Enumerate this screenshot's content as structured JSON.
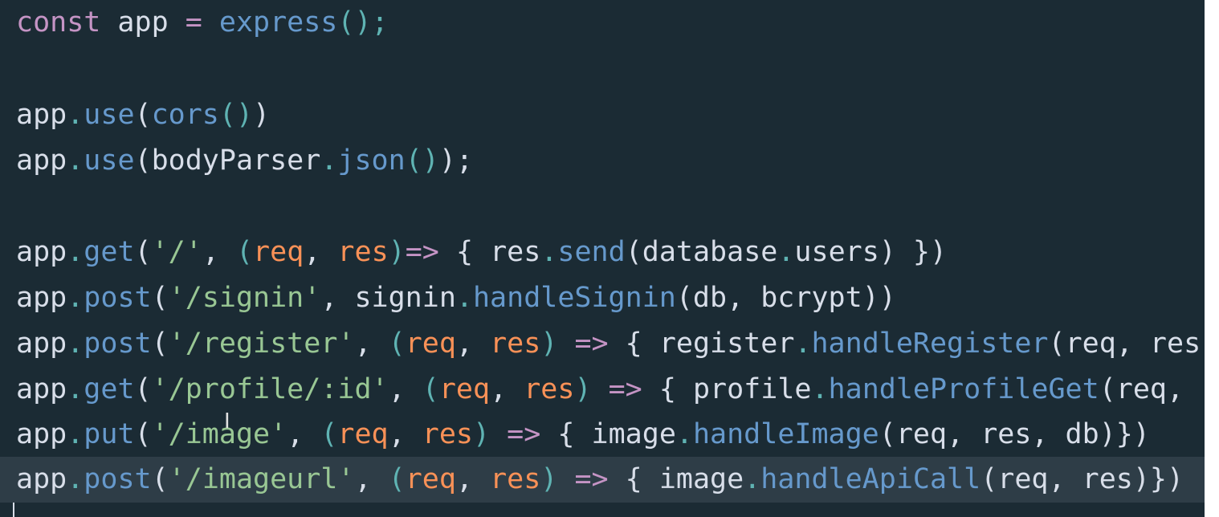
{
  "editor": {
    "lines": [
      {
        "tokens": [
          {
            "t": "const",
            "c": "kw"
          },
          {
            "t": " app ",
            "c": "id"
          },
          {
            "t": "=",
            "c": "op"
          },
          {
            "t": " ",
            "c": "id"
          },
          {
            "t": "express",
            "c": "fn"
          },
          {
            "t": "();",
            "c": "punc"
          }
        ]
      },
      {
        "tokens": []
      },
      {
        "tokens": [
          {
            "t": "app",
            "c": "id"
          },
          {
            "t": ".",
            "c": "punc"
          },
          {
            "t": "use",
            "c": "fn"
          },
          {
            "t": "(",
            "c": "id"
          },
          {
            "t": "cors",
            "c": "fn"
          },
          {
            "t": "()",
            "c": "punc"
          },
          {
            "t": ")",
            "c": "id"
          }
        ]
      },
      {
        "tokens": [
          {
            "t": "app",
            "c": "id"
          },
          {
            "t": ".",
            "c": "punc"
          },
          {
            "t": "use",
            "c": "fn"
          },
          {
            "t": "(bodyParser",
            "c": "id"
          },
          {
            "t": ".",
            "c": "punc"
          },
          {
            "t": "json",
            "c": "fn"
          },
          {
            "t": "()",
            "c": "punc"
          },
          {
            "t": ");",
            "c": "id"
          }
        ]
      },
      {
        "tokens": []
      },
      {
        "tokens": [
          {
            "t": "app",
            "c": "id"
          },
          {
            "t": ".",
            "c": "punc"
          },
          {
            "t": "get",
            "c": "fn"
          },
          {
            "t": "(",
            "c": "id"
          },
          {
            "t": "'/'",
            "c": "str"
          },
          {
            "t": ", ",
            "c": "id"
          },
          {
            "t": "(",
            "c": "punc"
          },
          {
            "t": "req",
            "c": "param"
          },
          {
            "t": ", ",
            "c": "id"
          },
          {
            "t": "res",
            "c": "param"
          },
          {
            "t": ")",
            "c": "punc"
          },
          {
            "t": "=>",
            "c": "op"
          },
          {
            "t": " { res",
            "c": "id"
          },
          {
            "t": ".",
            "c": "punc"
          },
          {
            "t": "send",
            "c": "fn"
          },
          {
            "t": "(database",
            "c": "id"
          },
          {
            "t": ".",
            "c": "punc"
          },
          {
            "t": "users) })",
            "c": "id"
          }
        ]
      },
      {
        "tokens": [
          {
            "t": "app",
            "c": "id"
          },
          {
            "t": ".",
            "c": "punc"
          },
          {
            "t": "post",
            "c": "fn"
          },
          {
            "t": "(",
            "c": "id"
          },
          {
            "t": "'/signin'",
            "c": "str"
          },
          {
            "t": ", signin",
            "c": "id"
          },
          {
            "t": ".",
            "c": "punc"
          },
          {
            "t": "handleSignin",
            "c": "fn"
          },
          {
            "t": "(db, bcrypt))",
            "c": "id"
          }
        ]
      },
      {
        "tokens": [
          {
            "t": "app",
            "c": "id"
          },
          {
            "t": ".",
            "c": "punc"
          },
          {
            "t": "post",
            "c": "fn"
          },
          {
            "t": "(",
            "c": "id"
          },
          {
            "t": "'/register'",
            "c": "str"
          },
          {
            "t": ", ",
            "c": "id"
          },
          {
            "t": "(",
            "c": "punc"
          },
          {
            "t": "req",
            "c": "param"
          },
          {
            "t": ", ",
            "c": "id"
          },
          {
            "t": "res",
            "c": "param"
          },
          {
            "t": ")",
            "c": "punc"
          },
          {
            "t": " ",
            "c": "id"
          },
          {
            "t": "=>",
            "c": "op"
          },
          {
            "t": " { register",
            "c": "id"
          },
          {
            "t": ".",
            "c": "punc"
          },
          {
            "t": "handleRegister",
            "c": "fn"
          },
          {
            "t": "(req, res",
            "c": "id"
          }
        ]
      },
      {
        "tokens": [
          {
            "t": "app",
            "c": "id"
          },
          {
            "t": ".",
            "c": "punc"
          },
          {
            "t": "get",
            "c": "fn"
          },
          {
            "t": "(",
            "c": "id"
          },
          {
            "t": "'/profile/:id'",
            "c": "str"
          },
          {
            "t": ", ",
            "c": "id"
          },
          {
            "t": "(",
            "c": "punc"
          },
          {
            "t": "req",
            "c": "param"
          },
          {
            "t": ", ",
            "c": "id"
          },
          {
            "t": "res",
            "c": "param"
          },
          {
            "t": ")",
            "c": "punc"
          },
          {
            "t": " ",
            "c": "id"
          },
          {
            "t": "=>",
            "c": "op"
          },
          {
            "t": " { profile",
            "c": "id"
          },
          {
            "t": ".",
            "c": "punc"
          },
          {
            "t": "handleProfileGet",
            "c": "fn"
          },
          {
            "t": "(req,",
            "c": "id"
          }
        ]
      },
      {
        "tokens": [
          {
            "t": "app",
            "c": "id"
          },
          {
            "t": ".",
            "c": "punc"
          },
          {
            "t": "put",
            "c": "fn"
          },
          {
            "t": "(",
            "c": "id"
          },
          {
            "t": "'/image'",
            "c": "str"
          },
          {
            "t": ", ",
            "c": "id"
          },
          {
            "t": "(",
            "c": "punc"
          },
          {
            "t": "req",
            "c": "param"
          },
          {
            "t": ", ",
            "c": "id"
          },
          {
            "t": "res",
            "c": "param"
          },
          {
            "t": ")",
            "c": "punc"
          },
          {
            "t": " ",
            "c": "id"
          },
          {
            "t": "=>",
            "c": "op"
          },
          {
            "t": " { image",
            "c": "id"
          },
          {
            "t": ".",
            "c": "punc"
          },
          {
            "t": "handleImage",
            "c": "fn"
          },
          {
            "t": "(req, res, db)})",
            "c": "id"
          }
        ]
      },
      {
        "tokens": [
          {
            "t": "app",
            "c": "id"
          },
          {
            "t": ".",
            "c": "punc"
          },
          {
            "t": "post",
            "c": "fn"
          },
          {
            "t": "(",
            "c": "id"
          },
          {
            "t": "'/imageurl'",
            "c": "str"
          },
          {
            "t": ", ",
            "c": "id"
          },
          {
            "t": "(",
            "c": "punc"
          },
          {
            "t": "req",
            "c": "param"
          },
          {
            "t": ", ",
            "c": "id"
          },
          {
            "t": "res",
            "c": "param"
          },
          {
            "t": ")",
            "c": "punc"
          },
          {
            "t": " ",
            "c": "id"
          },
          {
            "t": "=>",
            "c": "op"
          },
          {
            "t": " { image",
            "c": "id"
          },
          {
            "t": ".",
            "c": "punc"
          },
          {
            "t": "handleApiCall",
            "c": "fn"
          },
          {
            "t": "(req, res)})",
            "c": "id"
          }
        ]
      }
    ],
    "highlighted_line": 10,
    "colors": {
      "background": "#1b2b34",
      "line_highlight": "#2e3d47",
      "keyword": "#c594c5",
      "function": "#6699cc",
      "string": "#99c794",
      "parameter": "#f99157",
      "punctuation": "#5fb3b3",
      "identifier": "#d8dee9"
    }
  },
  "icons": {
    "mouse_cursor": "text-cursor-icon"
  }
}
